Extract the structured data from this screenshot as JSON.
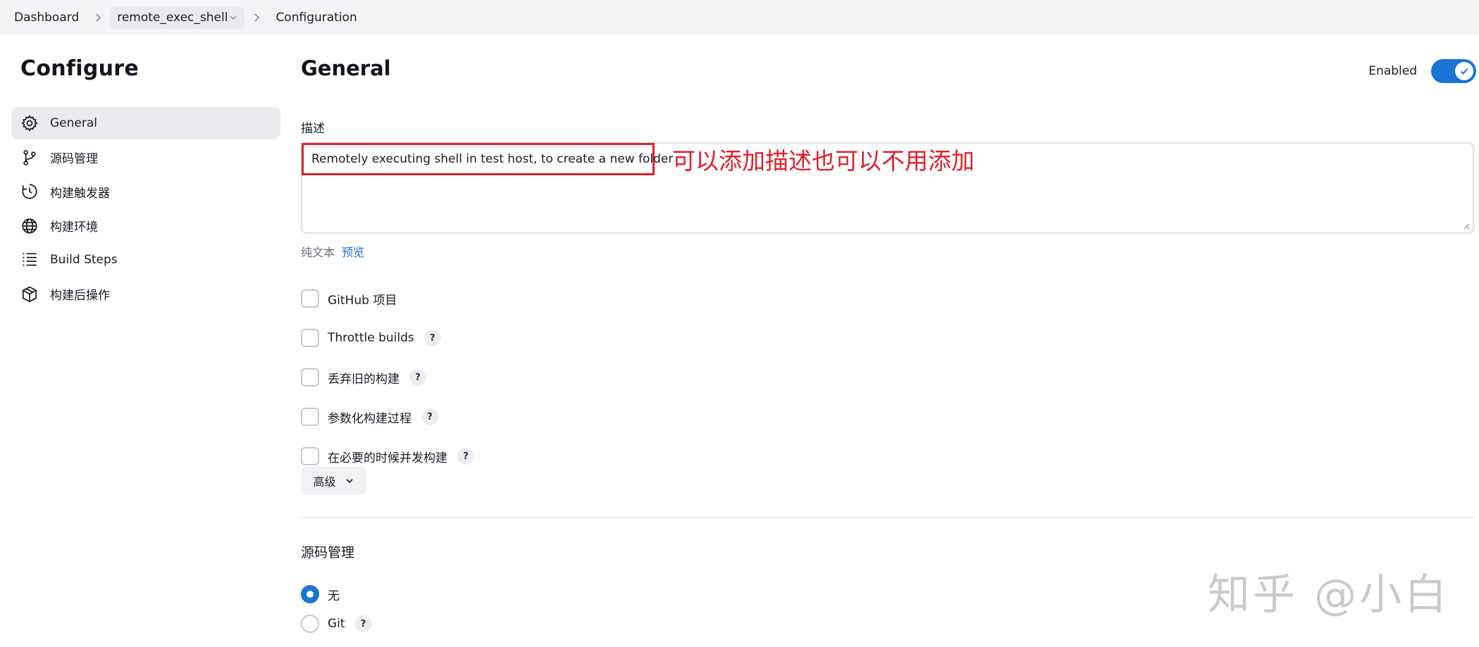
{
  "breadcrumb": {
    "items": [
      "Dashboard",
      "remote_exec_shell",
      "Configuration"
    ]
  },
  "sidebar": {
    "title": "Configure",
    "items": [
      {
        "label": "General",
        "icon": "gear-icon",
        "active": true
      },
      {
        "label": "源码管理",
        "icon": "branch-icon"
      },
      {
        "label": "构建触发器",
        "icon": "clock-icon"
      },
      {
        "label": "构建环境",
        "icon": "globe-icon"
      },
      {
        "label": "Build Steps",
        "icon": "list-icon"
      },
      {
        "label": "构建后操作",
        "icon": "package-icon"
      }
    ]
  },
  "main": {
    "title": "General",
    "enabled_label": "Enabled",
    "enabled": true,
    "description": {
      "label": "描述",
      "value": "Remotely executing shell in test host, to create a new folder",
      "annotation": "可以添加描述也可以不用添加",
      "plain_text": "纯文本",
      "preview": "预览"
    },
    "options": [
      {
        "label": "GitHub 项目",
        "help": false
      },
      {
        "label": "Throttle builds",
        "help": true
      },
      {
        "label": "丢弃旧的构建",
        "help": true
      },
      {
        "label": "参数化构建过程",
        "help": true
      },
      {
        "label": "在必要的时候并发构建",
        "help": true
      }
    ],
    "advanced_label": "高级",
    "help_glyph": "?",
    "scm": {
      "title": "源码管理",
      "options": [
        {
          "label": "无",
          "checked": true,
          "help": false
        },
        {
          "label": "Git",
          "checked": false,
          "help": true
        }
      ]
    }
  },
  "watermark": "知乎 @小白",
  "colors": {
    "accent": "#1a73d6",
    "annotation_red": "#e0202b",
    "link_blue": "#1a6fcf"
  }
}
